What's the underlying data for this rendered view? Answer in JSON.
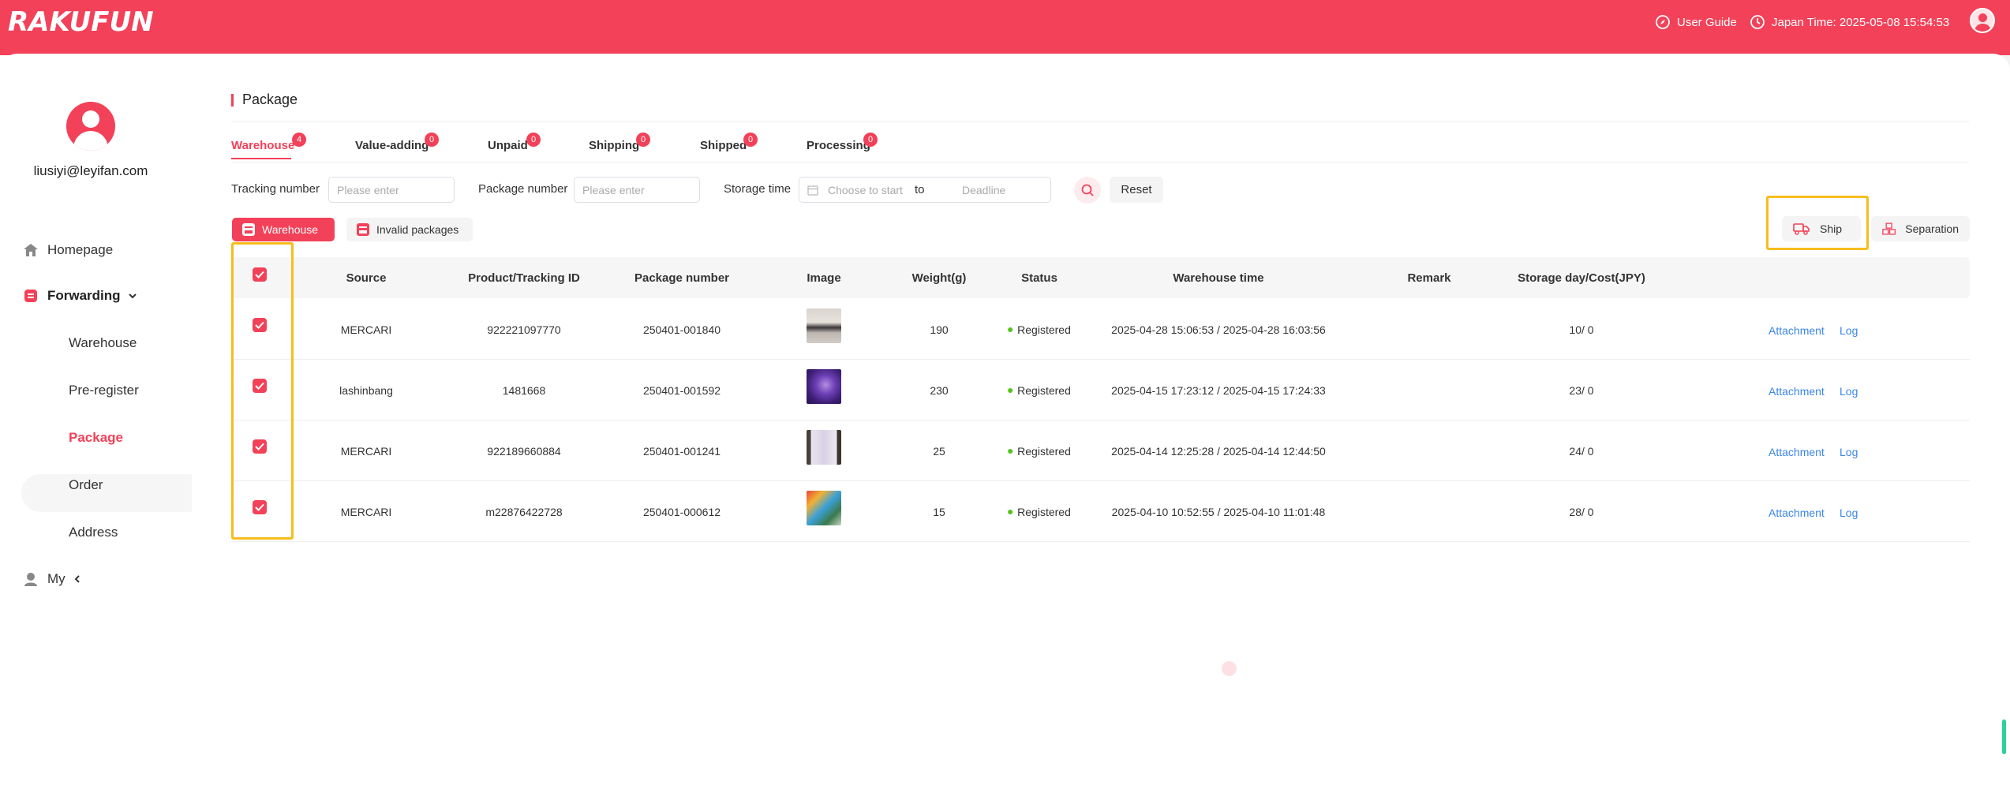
{
  "header": {
    "logo": "RAKUFUN",
    "user_guide": "User Guide",
    "japan_time": "Japan Time: 2025-05-08 15:54:53"
  },
  "sidebar": {
    "email": "liusiyi@leyifan.com",
    "homepage": "Homepage",
    "forwarding": "Forwarding",
    "sub_items": [
      "Warehouse",
      "Pre-register",
      "Package",
      "Order",
      "Address"
    ],
    "active_item": "Package",
    "my": "My",
    "accent_color": "#f24158"
  },
  "main": {
    "title": "Package",
    "tabs": [
      {
        "label": "Warehouse",
        "count": "4"
      },
      {
        "label": "Value-adding",
        "count": "0"
      },
      {
        "label": "Unpaid",
        "count": "0"
      },
      {
        "label": "Shipping",
        "count": "0"
      },
      {
        "label": "Shipped",
        "count": "0"
      },
      {
        "label": "Processing",
        "count": "0"
      }
    ],
    "filters": {
      "tracking_label": "Tracking number",
      "tracking_placeholder": "Please enter",
      "package_label": "Package number",
      "package_placeholder": "Please enter",
      "storage_label": "Storage time",
      "start_placeholder": "Choose to start",
      "to": "to",
      "deadline_placeholder": "Deadline",
      "reset": "Reset"
    },
    "pills": {
      "warehouse": "Warehouse",
      "invalid": "Invalid packages"
    },
    "actions": {
      "ship": "Ship",
      "separation": "Separation"
    },
    "table": {
      "columns": [
        "Source",
        "Product/Tracking ID",
        "Package number",
        "Image",
        "Weight(g)",
        "Status",
        "Warehouse time",
        "Remark",
        "Storage day/Cost(JPY)"
      ],
      "rows": [
        {
          "source": "MERCARI",
          "tracking": "922221097770",
          "package": "250401-001840",
          "weight": "190",
          "status": "Registered",
          "time": "2025-04-28 15:06:53 / 2025-04-28 16:03:56",
          "remark": "",
          "storage": "10/ 0",
          "attachment": "Attachment",
          "log": "Log"
        },
        {
          "source": "lashinbang",
          "tracking": "1481668",
          "package": "250401-001592",
          "weight": "230",
          "status": "Registered",
          "time": "2025-04-15 17:23:12 / 2025-04-15 17:24:33",
          "remark": "",
          "storage": "23/ 0",
          "attachment": "Attachment",
          "log": "Log"
        },
        {
          "source": "MERCARI",
          "tracking": "922189660884",
          "package": "250401-001241",
          "weight": "25",
          "status": "Registered",
          "time": "2025-04-14 12:25:28 / 2025-04-14 12:44:50",
          "remark": "",
          "storage": "24/ 0",
          "attachment": "Attachment",
          "log": "Log"
        },
        {
          "source": "MERCARI",
          "tracking": "m22876422728",
          "package": "250401-000612",
          "weight": "15",
          "status": "Registered",
          "time": "2025-04-10 10:52:55 / 2025-04-10 11:01:48",
          "remark": "",
          "storage": "28/ 0",
          "attachment": "Attachment",
          "log": "Log"
        }
      ]
    }
  }
}
